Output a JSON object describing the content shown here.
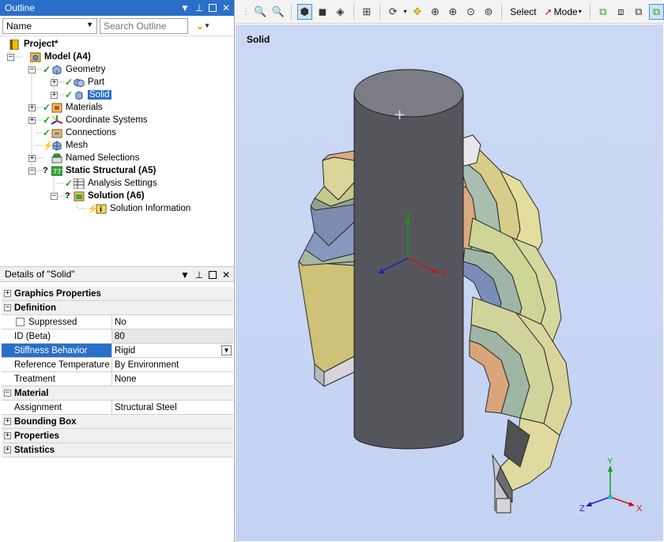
{
  "outline": {
    "title": "Outline",
    "name_filter": "Name",
    "search_placeholder": "Search Outline",
    "tree": [
      {
        "label": "Project*"
      },
      {
        "label": "Model (A4)"
      },
      {
        "label": "Geometry"
      },
      {
        "label": "Part"
      },
      {
        "label": "Solid"
      },
      {
        "label": "Materials"
      },
      {
        "label": "Coordinate Systems"
      },
      {
        "label": "Connections"
      },
      {
        "label": "Mesh"
      },
      {
        "label": "Named Selections"
      },
      {
        "label": "Static Structural (A5)"
      },
      {
        "label": "Analysis Settings"
      },
      {
        "label": "Solution (A6)"
      },
      {
        "label": "Solution Information"
      }
    ]
  },
  "details": {
    "title": "Details of \"Solid\"",
    "rows": [
      {
        "label": "Graphics Properties",
        "expand": "+"
      },
      {
        "label": "Definition",
        "expand": "−"
      },
      {
        "label": "Suppressed",
        "value": "No"
      },
      {
        "label": "ID (Beta)",
        "value": "80"
      },
      {
        "label": "Stiffness Behavior",
        "value": "Rigid"
      },
      {
        "label": "Reference Temperature",
        "value": "By Environment"
      },
      {
        "label": "Treatment",
        "value": "None"
      },
      {
        "label": "Material",
        "expand": "−"
      },
      {
        "label": "Assignment",
        "value": "Structural Steel"
      },
      {
        "label": "Bounding Box",
        "expand": "+"
      },
      {
        "label": "Properties",
        "expand": "+"
      },
      {
        "label": "Statistics",
        "expand": "+"
      }
    ]
  },
  "toolbar": {
    "select_label": "Select",
    "mode_label": "Mode"
  },
  "viewport": {
    "title": "Solid",
    "axes": {
      "x": "X",
      "y": "Y",
      "z": "Z"
    }
  },
  "colors": {
    "accent": "#2a6fc9",
    "viewport_bg": "#c8d5f4",
    "shaft": "#5b5b60",
    "axis_x": "#d01010",
    "axis_y": "#10a010",
    "axis_z": "#1020d0"
  }
}
